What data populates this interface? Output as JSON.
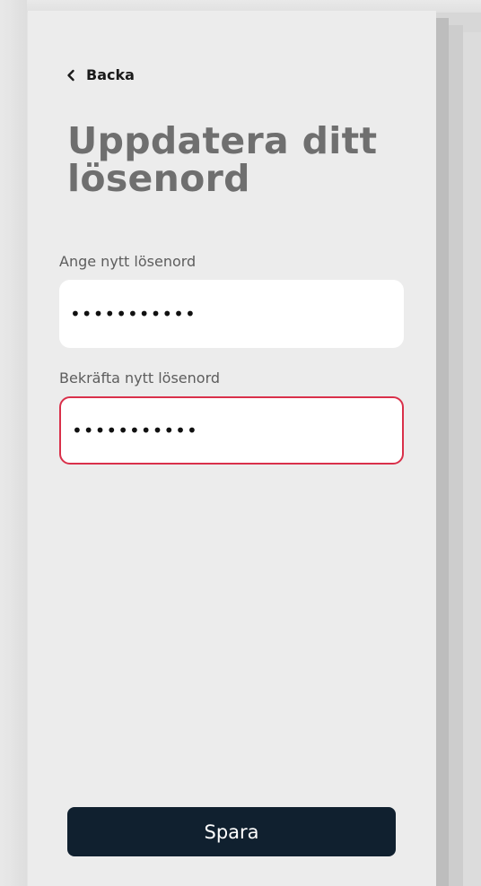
{
  "nav": {
    "back_label": "Backa",
    "back_icon": "chevron-left-icon"
  },
  "page": {
    "title": "Uppdatera ditt lösenord"
  },
  "form": {
    "new_password_label": "Ange nytt lösenord",
    "new_password_value": "•••••••••••",
    "confirm_password_label": "Bekräfta nytt lösenord",
    "confirm_password_value": "•••••••••••",
    "confirm_error_color": "#d9304a"
  },
  "actions": {
    "save_label": "Spara",
    "save_color": "#10202f"
  }
}
